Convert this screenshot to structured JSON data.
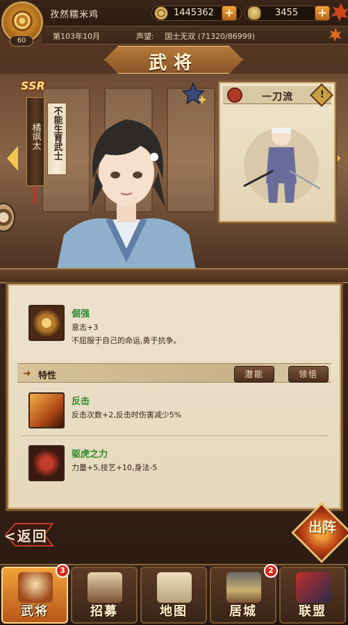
{
  "player": {
    "name": "孜然糯米鸡",
    "level": "60",
    "date": "第103年10月",
    "fame_label": "声望:",
    "fame_value": "国士无双 (71320/86999)"
  },
  "resources": {
    "coins": "1445362",
    "rice": "3455"
  },
  "page": {
    "title": "武将"
  },
  "hero": {
    "rarity": "SSR",
    "name": "橘飒太",
    "trait_tag": "不能生育武士",
    "style_name": "一刀流",
    "style_warning": "!"
  },
  "skills": {
    "main": {
      "name": "倔强",
      "line1": "意志+3",
      "line2": "不屈服于自己的命运,勇于抗争。"
    },
    "traits_label": "特性",
    "buttons": {
      "potential": "潜能",
      "comprehend": "领悟"
    },
    "traits": [
      {
        "name": "反击",
        "desc": "反击次数+2,反击时伤害减少5%"
      },
      {
        "name": "驱虎之力",
        "desc": "力量+5,技艺+10,身法-5"
      }
    ]
  },
  "actions": {
    "back": "<返回",
    "sortie": "出阵"
  },
  "nav": [
    {
      "label": "武将",
      "badge": "3"
    },
    {
      "label": "招募",
      "badge": ""
    },
    {
      "label": "地图",
      "badge": ""
    },
    {
      "label": "居城",
      "badge": "2"
    },
    {
      "label": "联盟",
      "badge": ""
    }
  ],
  "colors": {
    "accent": "#f2a23a",
    "skill_name": "#2e8a2e",
    "panel": "#ece2cc",
    "badge": "#d8281e"
  }
}
